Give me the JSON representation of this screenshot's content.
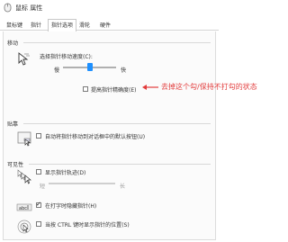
{
  "window": {
    "title": "鼠标 属性"
  },
  "tabs": [
    {
      "label": "鼠标键"
    },
    {
      "label": "指针"
    },
    {
      "label": "指针选项"
    },
    {
      "label": "滑轮"
    },
    {
      "label": "硬件"
    }
  ],
  "motion": {
    "title": "移动",
    "speed_label": "选择指针移动速度(C):",
    "slow": "慢",
    "fast": "快",
    "speed_level": 0.5,
    "precision_label": "提高指针精确度(E)",
    "precision_checked": false
  },
  "annotation": {
    "text": "去掉这个勾/保持不打勾的状态",
    "color": "#e23b3b"
  },
  "snap": {
    "title": "贴靠",
    "label": "自动将指针移动到对话框中的默认按钮(U)",
    "checked": false
  },
  "visibility": {
    "title": "可见性",
    "trails_label": "显示指针轨迹(D)",
    "trails_checked": false,
    "short": "短",
    "long": "长",
    "hide_label": "在打字时隐藏指针(H)",
    "hide_checked": true,
    "ctrl_label": "当按 CTRL 键时显示指针的位置(S)",
    "ctrl_checked": false
  }
}
